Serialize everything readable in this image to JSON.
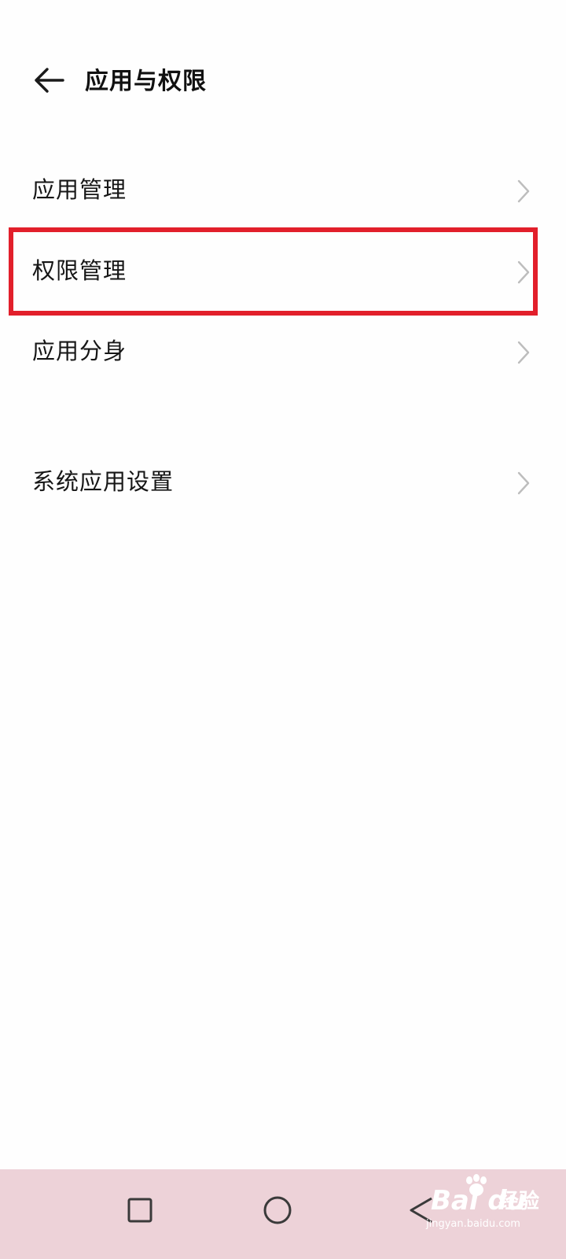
{
  "header": {
    "title": "应用与权限",
    "back_icon": "arrow-left-icon"
  },
  "menu": {
    "items": [
      {
        "label": "应用管理",
        "icon": "chevron-right-icon"
      },
      {
        "label": "权限管理",
        "icon": "chevron-right-icon",
        "highlighted": true
      },
      {
        "label": "应用分身",
        "icon": "chevron-right-icon"
      },
      {
        "label": "系统应用设置",
        "icon": "chevron-right-icon"
      }
    ]
  },
  "highlight": {
    "color": "#e21f2b"
  },
  "navbar": {
    "background": "#edd2d8",
    "buttons": [
      "recents-square-icon",
      "home-circle-icon",
      "back-triangle-icon"
    ]
  },
  "watermark": {
    "logo": "Bai du",
    "brand": "经验",
    "url": "jingyan.baidu.com"
  }
}
